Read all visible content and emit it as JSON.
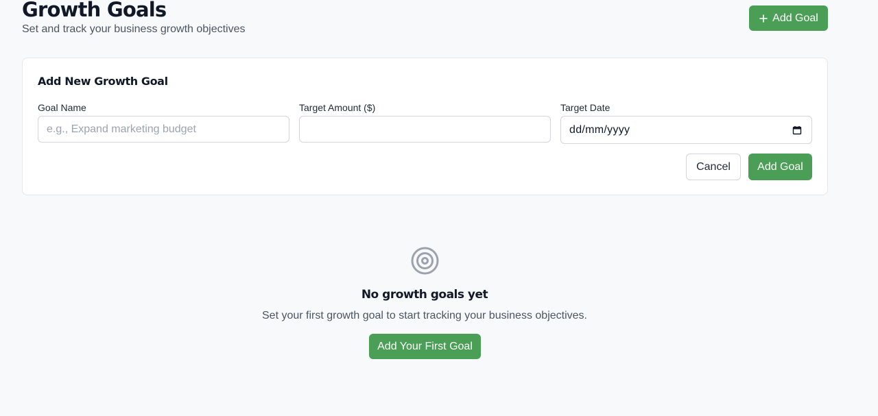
{
  "header": {
    "title": "Growth Goals",
    "subtitle": "Set and track your business growth objectives",
    "add_button_label": "Add Goal",
    "add_button_icon": "plus-icon"
  },
  "form": {
    "title": "Add New Growth Goal",
    "fields": {
      "goal_name": {
        "label": "Goal Name",
        "placeholder": "e.g., Expand marketing budget",
        "value": ""
      },
      "target_amount": {
        "label": "Target Amount ($)",
        "placeholder": "",
        "value": ""
      },
      "target_date": {
        "label": "Target Date",
        "value": "dd/mm/yyyy",
        "icon": "calendar-icon"
      }
    },
    "cancel_label": "Cancel",
    "submit_label": "Add Goal"
  },
  "empty_state": {
    "icon": "target-icon",
    "title": "No growth goals yet",
    "text": "Set your first growth goal to start tracking your business objectives.",
    "button_label": "Add Your First Goal"
  },
  "colors": {
    "accent": "#4a9e55",
    "background": "#f8f9fb",
    "card": "#ffffff",
    "border": "#e5e7eb",
    "icon_muted": "#9ca3af"
  }
}
